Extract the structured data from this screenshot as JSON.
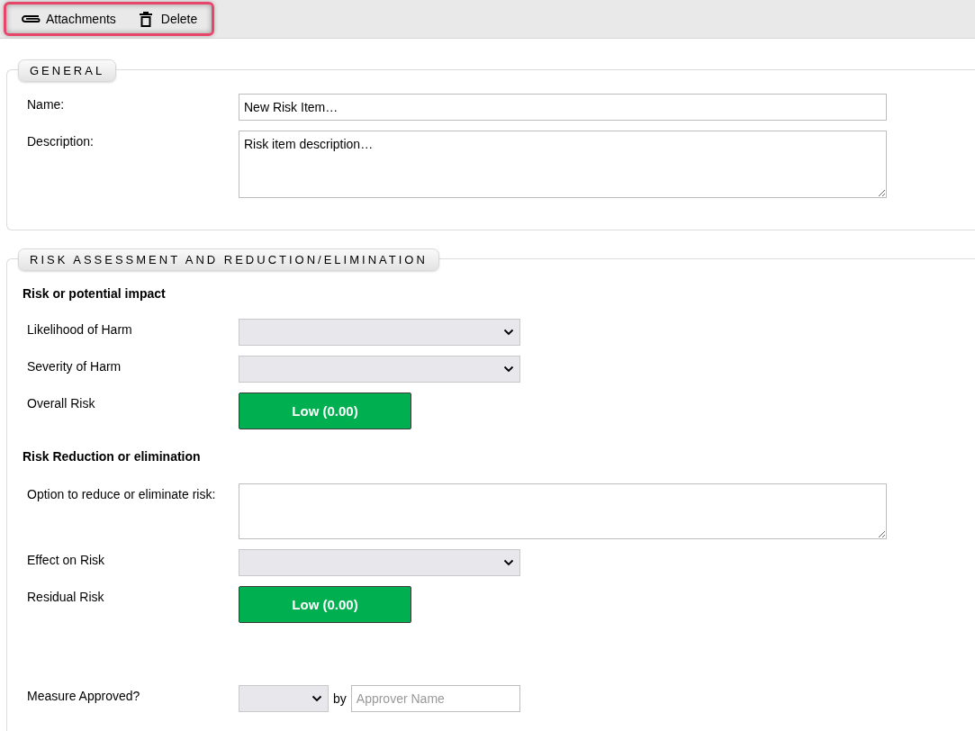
{
  "toolbar": {
    "highlighted": true,
    "buttons": [
      {
        "kind": "attach",
        "label": "Attachments"
      },
      {
        "kind": "delete",
        "label": "Delete"
      }
    ]
  },
  "sections": [
    {
      "legend": "GENERAL",
      "rows": [
        {
          "kind": "text",
          "label": "Name:",
          "value": "New Risk Item…"
        },
        {
          "kind": "textarea",
          "label": "Description:",
          "value": "Risk item description…"
        }
      ]
    },
    {
      "legend": "RISK ASSESSMENT AND REDUCTION/ELIMINATION",
      "rows": [
        {
          "kind": "heading",
          "label": "Risk or potential impact"
        },
        {
          "kind": "select",
          "label": "Likelihood of Harm"
        },
        {
          "kind": "select",
          "label": "Severity of Harm"
        },
        {
          "kind": "badge",
          "label": "Overall Risk",
          "value": "Low (0.00)"
        },
        {
          "kind": "heading",
          "label": "Risk Reduction or elimination"
        },
        {
          "kind": "textarea",
          "label": "Option to reduce or eliminate risk:",
          "value": ""
        },
        {
          "kind": "select",
          "label": "Effect on Risk"
        },
        {
          "kind": "badge",
          "label": "Residual Risk",
          "value": "Low (0.00)"
        },
        {
          "kind": "approval",
          "label": "Measure Approved?",
          "by": "by",
          "placeholder": "Approver Name"
        }
      ]
    }
  ]
}
